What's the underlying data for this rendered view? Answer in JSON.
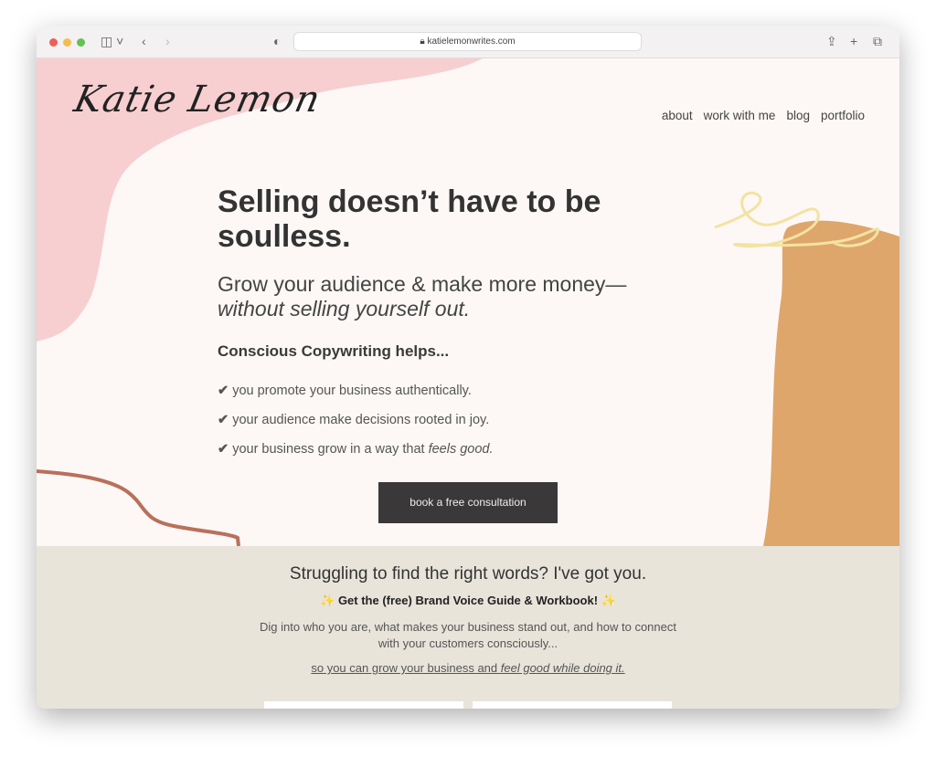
{
  "browser": {
    "url": "katielemonwrites.com"
  },
  "logo": "Katie Lemon",
  "nav": [
    {
      "label": "about"
    },
    {
      "label": "work with me"
    },
    {
      "label": "blog"
    },
    {
      "label": "portfolio"
    }
  ],
  "hero": {
    "headline": "Selling doesn’t have to be soulless.",
    "subhead": "Grow your audience & make more money—",
    "subhead_italic": "without selling yourself out.",
    "intro": "Conscious Copywriting helps...",
    "checks": [
      {
        "text": "you promote your business authentically."
      },
      {
        "text": "your audience make decisions rooted in joy."
      },
      {
        "text": "your business grow in a way that ",
        "italic": "feels good."
      }
    ],
    "cta": "book a free consultation"
  },
  "band": {
    "title": "Struggling to find the right words? I've got you.",
    "guide": "Get the (free) Brand Voice Guide & Workbook!",
    "desc": "Dig into who you are, what makes your business stand out, and how to connect with your customers consciously...",
    "link": "so you can grow your business and ",
    "link_italic": "feel good while doing it."
  },
  "colors": {
    "pink": "#f7cfd1",
    "orange": "#dea66b",
    "brown": "#b9705c",
    "yellow": "#f3e3a2",
    "band": "#e8e4da",
    "button": "#3b3839"
  }
}
